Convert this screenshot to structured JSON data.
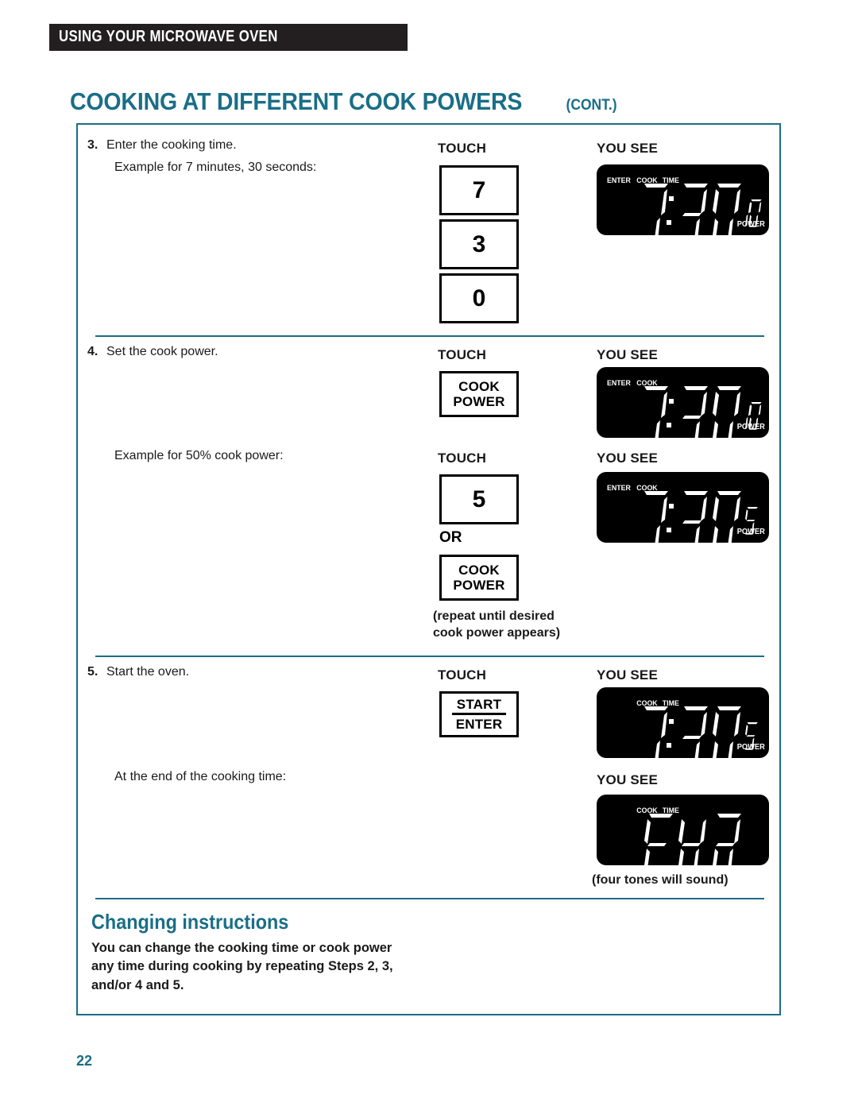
{
  "header": {
    "running_head": "USING YOUR MICROWAVE OVEN",
    "title_main": "Cooking at different cook powers",
    "title_cont": "(cont.)",
    "title_color": "#1a6e87",
    "banner_color": "#231f20"
  },
  "columns": {
    "touch": "TOUCH",
    "you_see": "YOU SEE"
  },
  "steps": [
    {
      "number": "3.",
      "title": "Enter the cooking time.",
      "example": "Example for 7 minutes, 30 seconds:",
      "keys": [
        {
          "type": "digit",
          "label": "7"
        },
        {
          "type": "digit",
          "label": "3"
        },
        {
          "type": "digit",
          "label": "0"
        }
      ],
      "display": {
        "indicators": [
          "ENTER",
          "COOK",
          "TIME"
        ],
        "time": "7:30",
        "power": "10",
        "power_label": "POWER"
      }
    },
    {
      "number": "4.",
      "title": "Set the cook power.",
      "keys": [
        {
          "type": "word",
          "line1": "COOK",
          "line2": "POWER"
        }
      ],
      "display": {
        "indicators": [
          "ENTER",
          "COOK"
        ],
        "time": "7:30",
        "power": "10",
        "power_label": "POWER"
      },
      "example": "Example for 50% cook power:",
      "example_keys": [
        {
          "type": "digit",
          "label": "5"
        },
        {
          "type": "or",
          "label": "OR"
        },
        {
          "type": "word",
          "line1": "COOK",
          "line2": "POWER"
        }
      ],
      "example_note_line1": "(repeat until desired",
      "example_note_line2": "cook power appears)",
      "example_display": {
        "indicators": [
          "ENTER",
          "COOK"
        ],
        "time": "7:30",
        "power": "5",
        "power_label": "POWER"
      }
    },
    {
      "number": "5.",
      "title": "Start the oven.",
      "keys": [
        {
          "type": "word",
          "line1": "START",
          "line2": "ENTER",
          "divided": true
        }
      ],
      "display": {
        "indicators": [
          "COOK",
          "TIME"
        ],
        "time": "7:30",
        "power": "5",
        "power_label": "POWER"
      },
      "end_text": "At the end of the cooking time:",
      "end_display": {
        "indicators": [
          "COOK",
          "TIME"
        ],
        "word": "END"
      },
      "end_note": "(four tones will sound)"
    }
  ],
  "changing": {
    "title": "Changing instructions",
    "line1": "You can change the cooking time or cook power",
    "line2": "any time during cooking by repeating Steps 2, 3,",
    "line3": "and/or 4 and 5."
  },
  "folio": "22"
}
